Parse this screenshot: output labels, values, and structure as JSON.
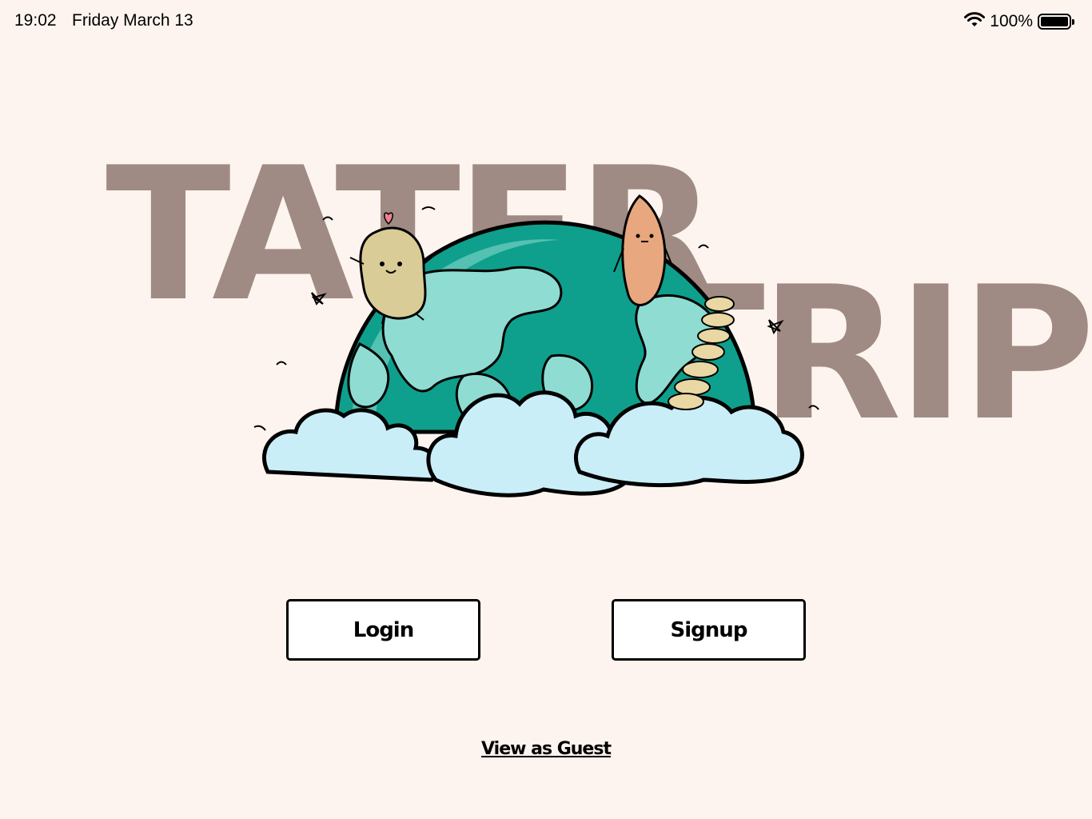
{
  "status_bar": {
    "time": "19:02",
    "date": "Friday March 13",
    "battery_percent": "100%",
    "battery_level": 1.0,
    "wifi_icon": "wifi-icon",
    "battery_icon": "battery-icon"
  },
  "logo": {
    "word_1": "TATER",
    "word_2": "TRIPS",
    "illustration": "globe-with-potatoes-and-clouds"
  },
  "actions": {
    "login_label": "Login",
    "signup_label": "Signup",
    "guest_label": "View as Guest"
  },
  "colors": {
    "background": "#fdf4ef",
    "logo_text": "#9f8b84",
    "globe_ocean": "#0f9f8d",
    "globe_land": "#8fdcd3",
    "cloud": "#c9eef8",
    "potato": "#d9cc97",
    "sweet_potato": "#e8a77f"
  }
}
